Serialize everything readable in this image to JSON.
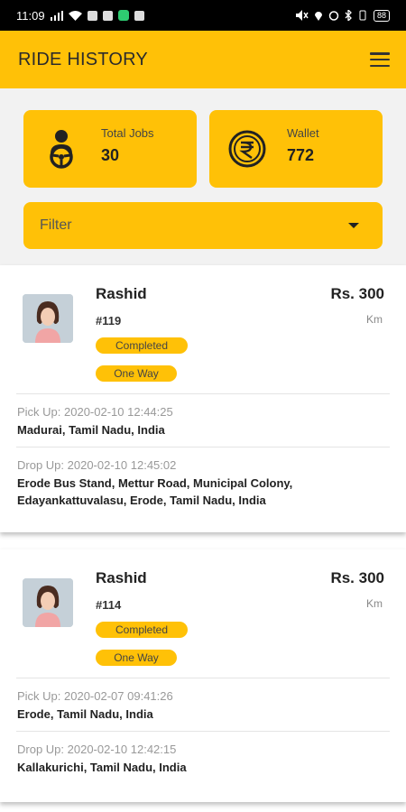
{
  "statusbar": {
    "time": "11:09",
    "battery": "88"
  },
  "appbar": {
    "title": "RIDE HISTORY"
  },
  "stats": {
    "total_jobs": {
      "label": "Total Jobs",
      "value": "30"
    },
    "wallet": {
      "label": "Wallet",
      "value": "772"
    }
  },
  "filter": {
    "label": "Filter"
  },
  "rides": [
    {
      "name": "Rashid",
      "id": "#119",
      "price": "Rs. 300",
      "unit": "Km",
      "status": "Completed",
      "trip_type": "One Way",
      "pickup_label": "Pick Up: 2020-02-10 12:44:25",
      "pickup_address": "Madurai, Tamil Nadu, India",
      "drop_label": "Drop Up: 2020-02-10 12:45:02",
      "drop_address": "Erode Bus Stand, Mettur Road, Municipal Colony, Edayankattuvalasu, Erode, Tamil Nadu, India"
    },
    {
      "name": "Rashid",
      "id": "#114",
      "price": "Rs. 300",
      "unit": "Km",
      "status": "Completed",
      "trip_type": "One Way",
      "pickup_label": "Pick Up: 2020-02-07 09:41:26",
      "pickup_address": "Erode, Tamil Nadu, India",
      "drop_label": "Drop Up: 2020-02-10 12:42:15",
      "drop_address": "Kallakurichi, Tamil Nadu, India"
    }
  ],
  "colors": {
    "accent": "#FFC107",
    "background": "#f2f2f2",
    "statusbar": "#000000"
  },
  "icons": [
    "menu-icon",
    "driver-icon",
    "rupee-icon",
    "caret-down-icon",
    "avatar"
  ]
}
